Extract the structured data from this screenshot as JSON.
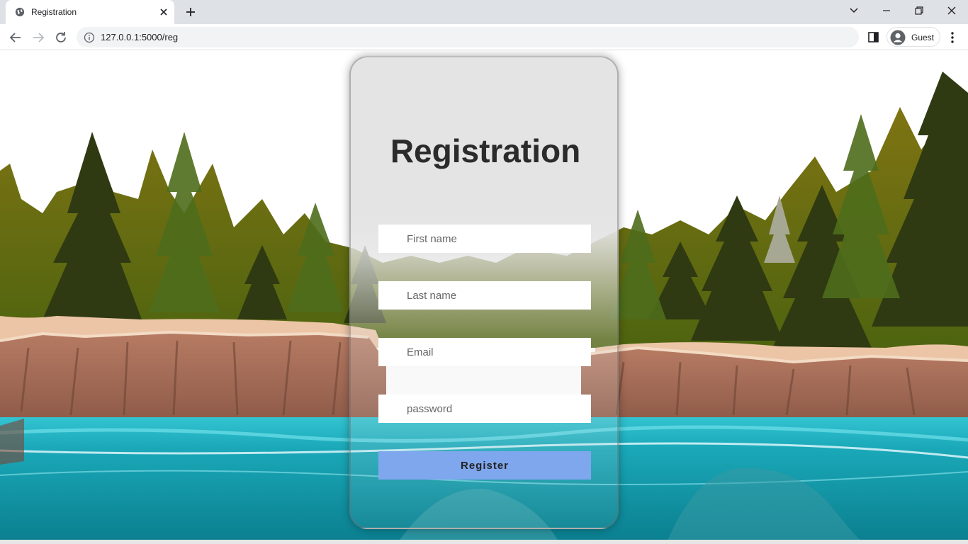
{
  "browser": {
    "tab_title": "Registration",
    "url": "127.0.0.1:5000/reg",
    "profile_name": "Guest"
  },
  "form": {
    "heading": "Registration",
    "first_name_placeholder": "First name",
    "last_name_placeholder": "Last name",
    "email_placeholder": "Email",
    "password_placeholder": "password",
    "register_label": "Register"
  },
  "colors": {
    "button": "#7fa7ee",
    "water": "#1a9fb0",
    "forest": "#6b6a12",
    "cliff": "#a9735f"
  }
}
